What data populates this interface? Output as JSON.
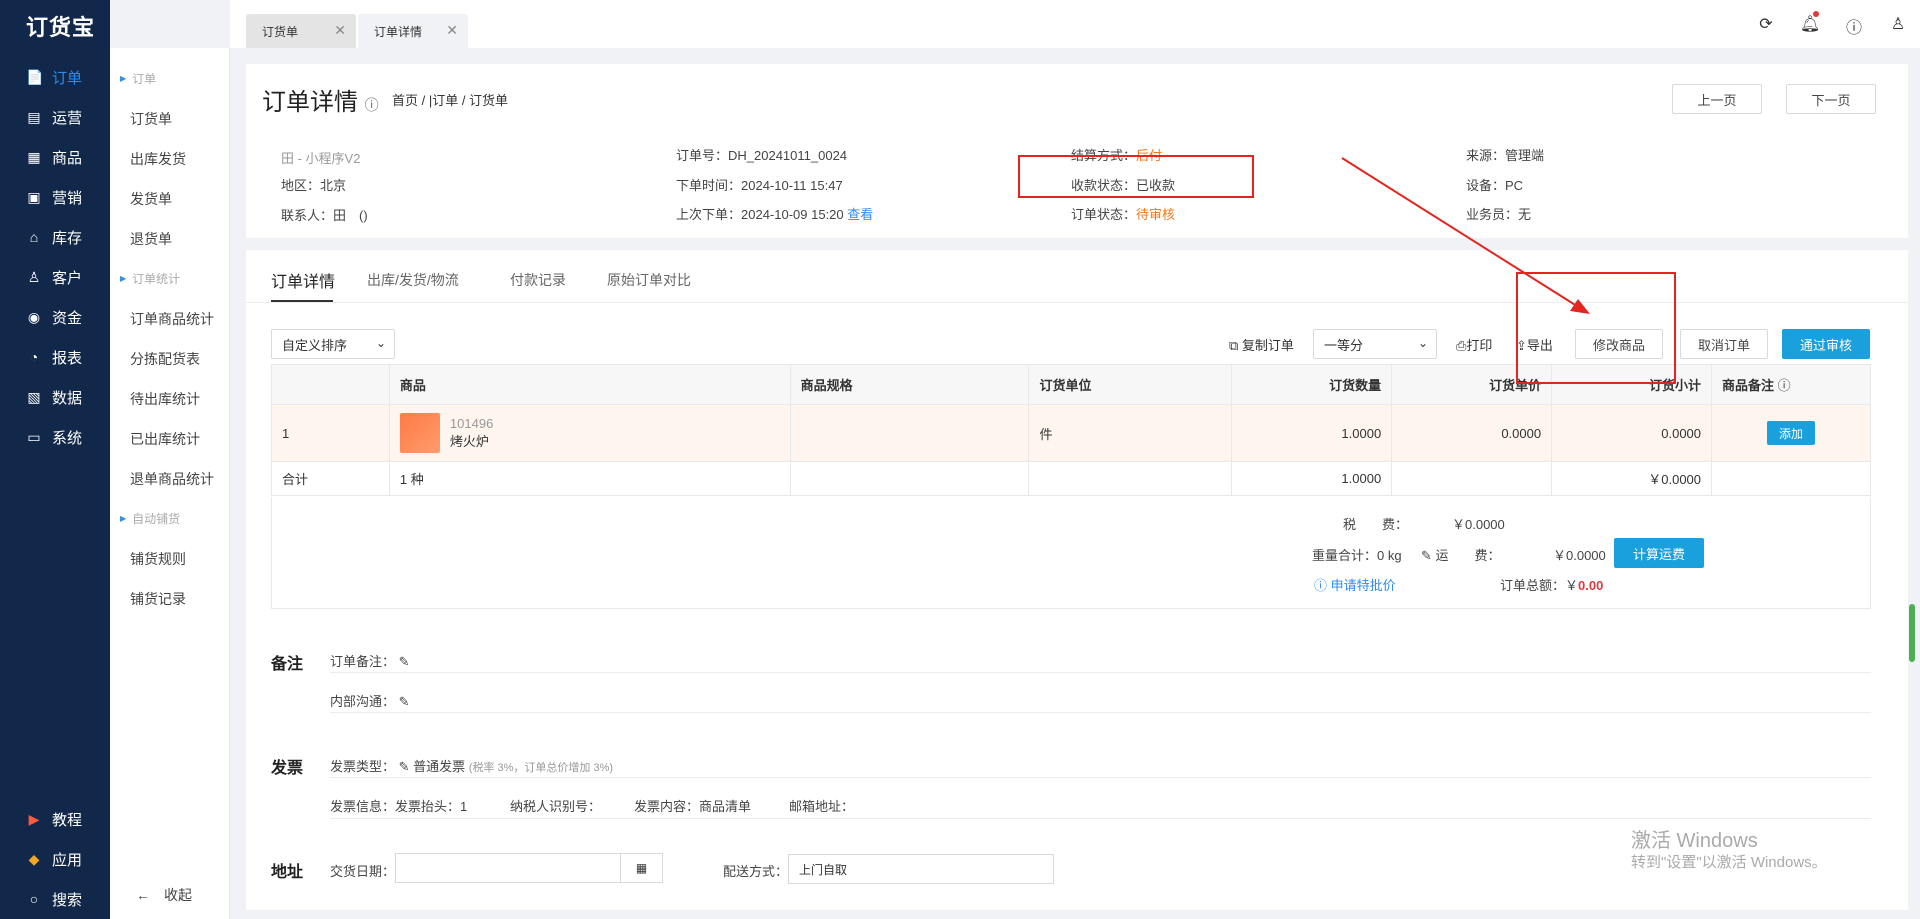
{
  "nav": {
    "logo": "订货宝",
    "items": [
      {
        "label": "订单",
        "icon": "📄"
      },
      {
        "label": "运营",
        "icon": "▤"
      },
      {
        "label": "商品",
        "icon": "▦"
      },
      {
        "label": "营销",
        "icon": "▣"
      },
      {
        "label": "库存",
        "icon": "⌂"
      },
      {
        "label": "客户",
        "icon": "♙"
      },
      {
        "label": "资金",
        "icon": "◉"
      },
      {
        "label": "报表",
        "icon": "◔"
      },
      {
        "label": "数据",
        "icon": "▧"
      },
      {
        "label": "系统",
        "icon": "▭"
      }
    ],
    "bottom": [
      {
        "label": "教程",
        "icon": "▶"
      },
      {
        "label": "应用",
        "icon": "◆"
      },
      {
        "label": "搜索",
        "icon": "○"
      }
    ]
  },
  "sub": {
    "groups": [
      "订单",
      "订单统计",
      "自动铺货"
    ],
    "items": [
      "订货单",
      "出库发货",
      "发货单",
      "退货单",
      "订单商品统计",
      "分拣配货表",
      "待出库统计",
      "已出库统计",
      "退单商品统计",
      "铺货规则",
      "铺货记录"
    ],
    "collapse": "收起"
  },
  "tabs": [
    "订货单",
    "订单详情"
  ],
  "header": {
    "title": "订单详情",
    "crumb": "首页 / |订单 / 订货单",
    "prev": "上一页",
    "next": "下一页"
  },
  "info": {
    "c1": [
      "田 - 小程序V2",
      "地区：北京",
      "联系人：田　()"
    ],
    "order_no": "订单号：DH_20241011_0024",
    "order_time": "下单时间：2024-10-11 15:47",
    "last_order": "上次下单：2024-10-09 15:20",
    "view": "查看",
    "settle_lbl": "结算方式：",
    "settle": "后付",
    "pay_status": "收款状态：已收款",
    "order_status_lbl": "订单状态：",
    "order_status": "待审核",
    "source": "来源：管理端",
    "device": "设备：PC",
    "sales": "业务员：无"
  },
  "subtabs": [
    "订单详情",
    "出库/发货/物流",
    "付款记录",
    "原始订单对比"
  ],
  "toolbar": {
    "sort": "自定义排序",
    "copy": "复制订单",
    "grade": "一等分",
    "print": "打印",
    "export": "导出",
    "modify": "修改商品",
    "cancel": "取消订单",
    "approve": "通过审核"
  },
  "table": {
    "headers": [
      "",
      "商品",
      "商品规格",
      "订货单位",
      "订货数量",
      "订货单价",
      "订货小计",
      "商品备注"
    ],
    "row": {
      "idx": "1",
      "code": "101496",
      "name": "烤火炉",
      "spec": "",
      "unit": "件",
      "qty": "1.0000",
      "price": "0.0000",
      "subtotal": "0.0000",
      "add": "添加"
    },
    "total": {
      "label": "合计",
      "kinds": "1 种",
      "qty": "1.0000",
      "subtotal": "￥0.0000"
    }
  },
  "summary": {
    "tax_lbl": "税　　费：",
    "tax": "￥0.0000",
    "weight": "重量合计：0 kg",
    "freight_lbl": "运　　费：",
    "freight": "￥0.0000",
    "calc": "计算运费",
    "special": "申请特批价",
    "total_lbl": "订单总额：",
    "total_cur": "￥",
    "total": "0.00"
  },
  "remark": {
    "title": "备注",
    "order_remark": "订单备注：",
    "internal": "内部沟通："
  },
  "invoice": {
    "title": "发票",
    "type_lbl": "发票类型：",
    "type": "普通发票",
    "type_note": "(税率 3%，订单总价增加 3%)",
    "info_lbl": "发票信息：",
    "head_lbl": "发票抬头：",
    "head": "1",
    "tax_id_lbl": "纳税人识别号：",
    "content_lbl": "发票内容：",
    "content": "商品清单",
    "mail_lbl": "邮箱地址："
  },
  "address": {
    "title": "地址",
    "date_lbl": "交货日期：",
    "ship_lbl": "配送方式：",
    "ship": "上门自取"
  },
  "watermark": {
    "line1": "激活 Windows",
    "line2": "转到\"设置\"以激活 Windows。"
  }
}
